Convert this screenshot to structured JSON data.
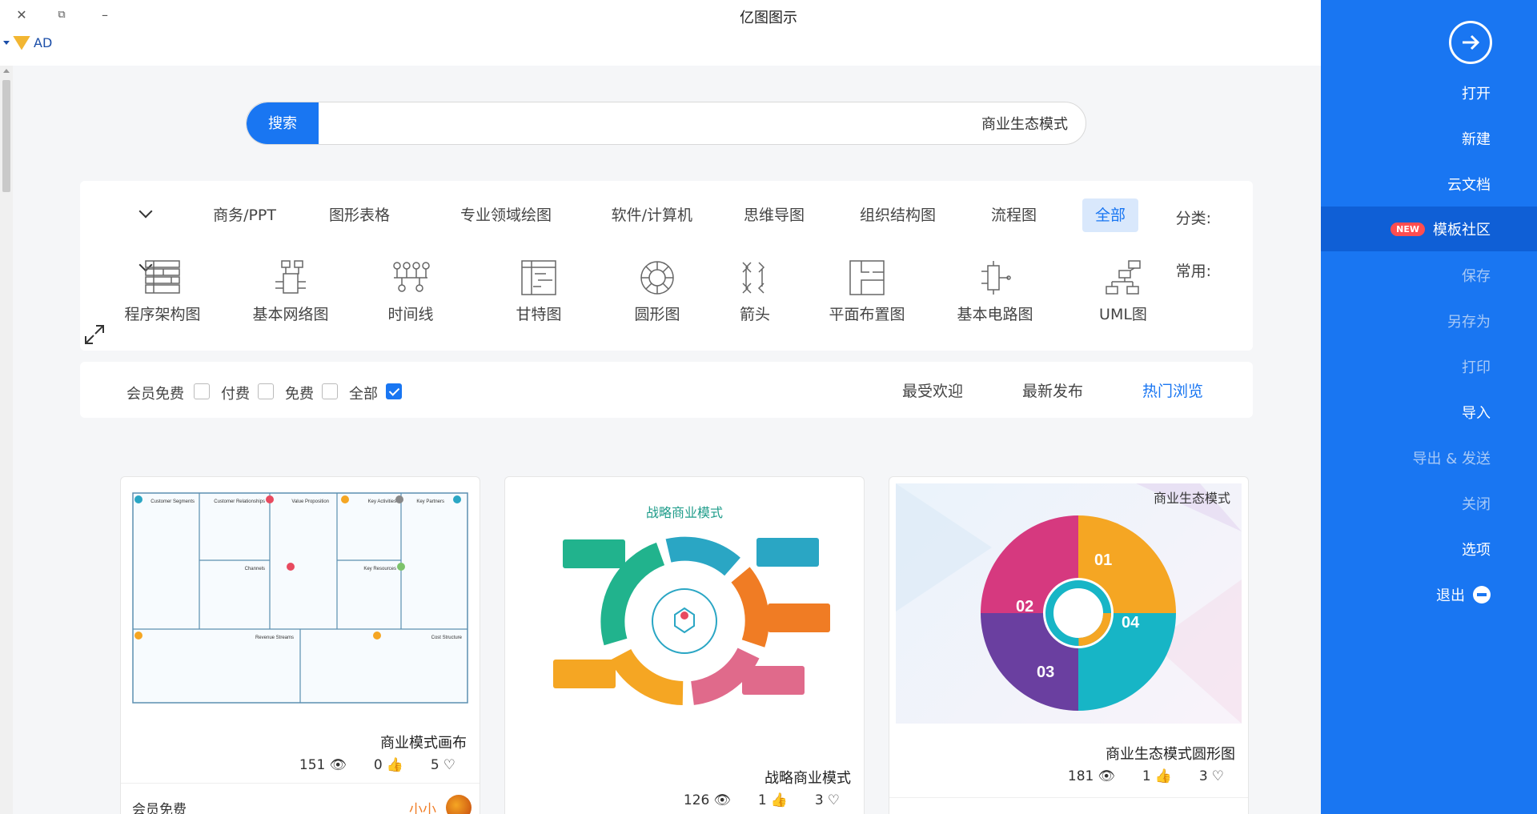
{
  "window": {
    "title": "亿图图示",
    "account": "AD"
  },
  "sidebar": {
    "items": [
      {
        "label": "打开"
      },
      {
        "label": "新建"
      },
      {
        "label": "云文档"
      },
      {
        "label": "模板社区",
        "badge": "NEW"
      },
      {
        "label": "保存"
      },
      {
        "label": "另存为"
      },
      {
        "label": "打印"
      },
      {
        "label": "导入"
      },
      {
        "label": "导出 & 发送"
      },
      {
        "label": "关闭"
      },
      {
        "label": "选项"
      },
      {
        "label": "退出"
      }
    ]
  },
  "search": {
    "button": "搜索",
    "value": "商业生态模式"
  },
  "categories": {
    "label": "分类:",
    "items": [
      "全部",
      "流程图",
      "组织结构图",
      "思维导图",
      "软件/计算机",
      "专业领域绘图",
      "图形表格",
      "商务/PPT"
    ]
  },
  "common": {
    "label": "常用:",
    "items": [
      "UML图",
      "基本电路图",
      "平面布置图",
      "箭头",
      "圆形图",
      "甘特图",
      "时间线",
      "基本网络图",
      "程序架构图"
    ]
  },
  "sort": {
    "items": [
      "热门浏览",
      "最新发布",
      "最受欢迎"
    ]
  },
  "filters": {
    "items": [
      "全部",
      "免费",
      "付费",
      "会员免费"
    ]
  },
  "cards": [
    {
      "title": "商业生态模式圆形图",
      "views": "181",
      "likes": "1",
      "favs": "3",
      "thumb_title": "商业生态模式",
      "segments": [
        "01",
        "02",
        "03",
        "04"
      ]
    },
    {
      "title": "战略商业模式",
      "views": "126",
      "likes": "1",
      "favs": "3",
      "thumb_title": "战略商业模式"
    },
    {
      "title": "商业模式画布",
      "views": "151",
      "likes": "0",
      "favs": "5",
      "author": "小小",
      "price": "会员免费",
      "thumb_headers": [
        "Key Partners",
        "Key Activities",
        "Value Proposition",
        "Customer Relationships",
        "Customer Segments",
        "Key Resources",
        "Channels",
        "Cost Structure",
        "Revenue Streams"
      ]
    }
  ],
  "colors": {
    "accent": "#1976f2",
    "accent_dark": "#0f5fd6",
    "badge": "#ff4d4f",
    "author": "#f07c24"
  }
}
